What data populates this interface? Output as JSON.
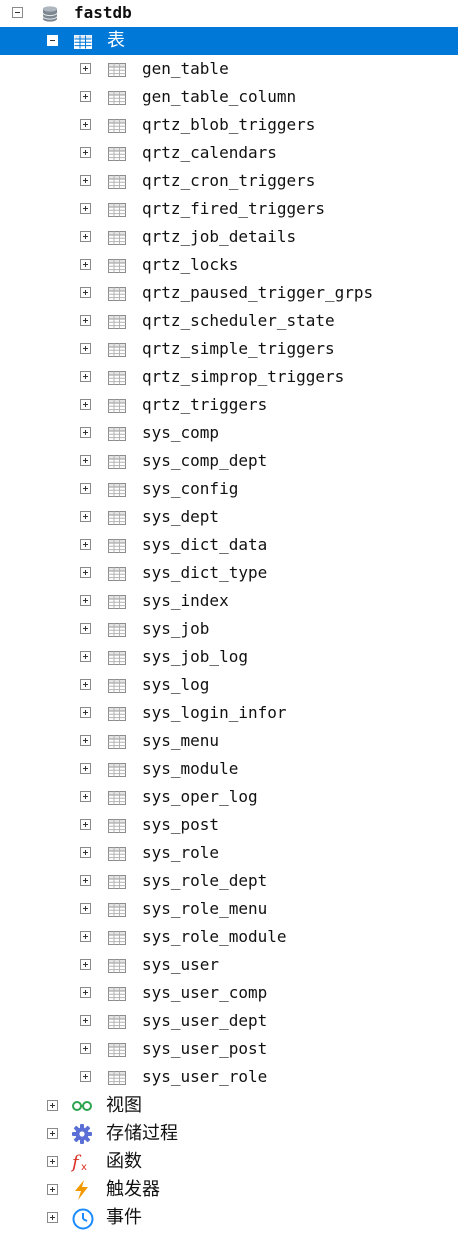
{
  "database": {
    "name": "fastdb",
    "icon": "database-icon"
  },
  "tables_node": {
    "label": "表",
    "icon": "table-icon",
    "expanded": true,
    "selected": true
  },
  "tables": [
    "gen_table",
    "gen_table_column",
    "qrtz_blob_triggers",
    "qrtz_calendars",
    "qrtz_cron_triggers",
    "qrtz_fired_triggers",
    "qrtz_job_details",
    "qrtz_locks",
    "qrtz_paused_trigger_grps",
    "qrtz_scheduler_state",
    "qrtz_simple_triggers",
    "qrtz_simprop_triggers",
    "qrtz_triggers",
    "sys_comp",
    "sys_comp_dept",
    "sys_config",
    "sys_dept",
    "sys_dict_data",
    "sys_dict_type",
    "sys_index",
    "sys_job",
    "sys_job_log",
    "sys_log",
    "sys_login_infor",
    "sys_menu",
    "sys_module",
    "sys_oper_log",
    "sys_post",
    "sys_role",
    "sys_role_dept",
    "sys_role_menu",
    "sys_role_module",
    "sys_user",
    "sys_user_comp",
    "sys_user_dept",
    "sys_user_post",
    "sys_user_role"
  ],
  "other_nodes": [
    {
      "label": "视图",
      "icon": "view-icon"
    },
    {
      "label": "存储过程",
      "icon": "procedure-icon"
    },
    {
      "label": "函数",
      "icon": "function-icon"
    },
    {
      "label": "触发器",
      "icon": "trigger-icon"
    },
    {
      "label": "事件",
      "icon": "event-icon"
    }
  ],
  "colors": {
    "selection": "#0078d7",
    "view_icon": "#2ea44f",
    "procedure_icon": "#5b6fd6",
    "function_icon": "#d93025",
    "trigger_icon": "#f29900",
    "event_icon": "#1a8cff"
  }
}
